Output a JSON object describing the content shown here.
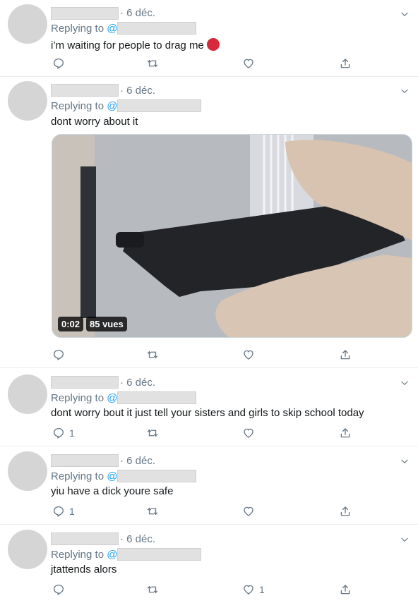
{
  "tweets": [
    {
      "date": "· 6 déc.",
      "reply_prefix": "Replying to ",
      "reply_at": "@",
      "text": "i’m waiting for people to drag me",
      "reply_count": "",
      "like_count": "",
      "emoji": "angry-face"
    },
    {
      "date": "· 6 déc.",
      "reply_prefix": "Replying to ",
      "reply_at": "@",
      "text": "dont worry about it",
      "reply_count": "",
      "like_count": "",
      "video": {
        "duration": "0:02",
        "views": "85 vues"
      }
    },
    {
      "date": "· 6 déc.",
      "reply_prefix": "Replying to ",
      "reply_at": "@",
      "text": "dont worry bout it just tell your sisters and girls to skip school today",
      "reply_count": "1",
      "like_count": ""
    },
    {
      "date": "· 6 déc.",
      "reply_prefix": "Replying to ",
      "reply_at": "@",
      "text": "yiu have a dick youre safe",
      "reply_count": "1",
      "like_count": ""
    },
    {
      "date": "· 6 déc.",
      "reply_prefix": "Replying to ",
      "reply_at": "@",
      "text": "jtattends alors",
      "reply_count": "",
      "like_count": "1"
    }
  ],
  "icons": {
    "reply": "reply-icon",
    "retweet": "retweet-icon",
    "like": "heart-icon",
    "share": "share-icon",
    "menu": "chevron-down-icon"
  },
  "colors": {
    "link": "#1da1f2",
    "muted": "#657786",
    "divider": "#e6ecf0"
  }
}
